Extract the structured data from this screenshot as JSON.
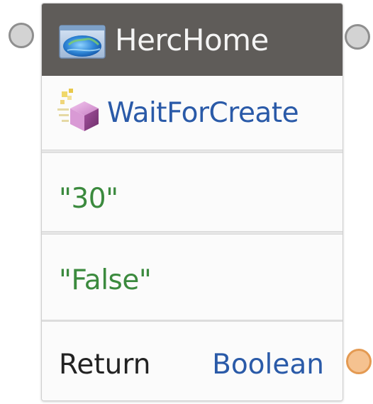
{
  "node": {
    "title": "HercHome",
    "title_icon": "globe-window-icon",
    "method": {
      "name": "WaitForCreate",
      "icon": "method-cube-icon"
    },
    "parameters": [
      {
        "value": "\"30\""
      },
      {
        "value": "\"False\""
      }
    ],
    "return": {
      "label": "Return",
      "type": "Boolean"
    }
  },
  "colors": {
    "header_bg": "#5f5c59",
    "method_text": "#2a5aa8",
    "literal_text": "#3b8a3e",
    "return_type_text": "#2a5aa8",
    "port_gray": "#d3d3d3",
    "port_return": "#f5c290"
  }
}
